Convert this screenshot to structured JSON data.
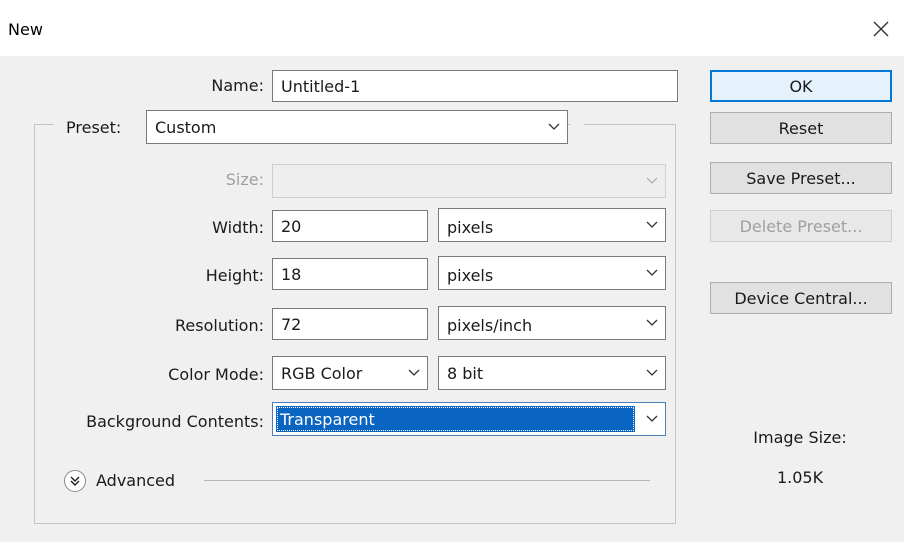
{
  "window": {
    "title": "New"
  },
  "form": {
    "name_label": "Name:",
    "name_value": "Untitled-1",
    "preset_label": "Preset:",
    "preset_value": "Custom",
    "size_label": "Size:",
    "size_value": "",
    "width_label": "Width:",
    "width_value": "20",
    "width_unit": "pixels",
    "height_label": "Height:",
    "height_value": "18",
    "height_unit": "pixels",
    "resolution_label": "Resolution:",
    "resolution_value": "72",
    "resolution_unit": "pixels/inch",
    "color_mode_label": "Color Mode:",
    "color_mode_value": "RGB Color",
    "bit_depth_value": "8 bit",
    "background_label": "Background Contents:",
    "background_value": "Transparent",
    "advanced_label": "Advanced"
  },
  "buttons": {
    "ok": "OK",
    "reset": "Reset",
    "save_preset": "Save Preset...",
    "delete_preset": "Delete Preset...",
    "device_central": "Device Central..."
  },
  "info": {
    "image_size_label": "Image Size:",
    "image_size_value": "1.05K"
  },
  "icons": {
    "close": "close-icon",
    "dropdown": "chevron-down-icon",
    "advanced_toggle": "double-chevron-down-icon"
  },
  "colors": {
    "selection": "#0a64c2",
    "primary_border": "#0078d7"
  }
}
